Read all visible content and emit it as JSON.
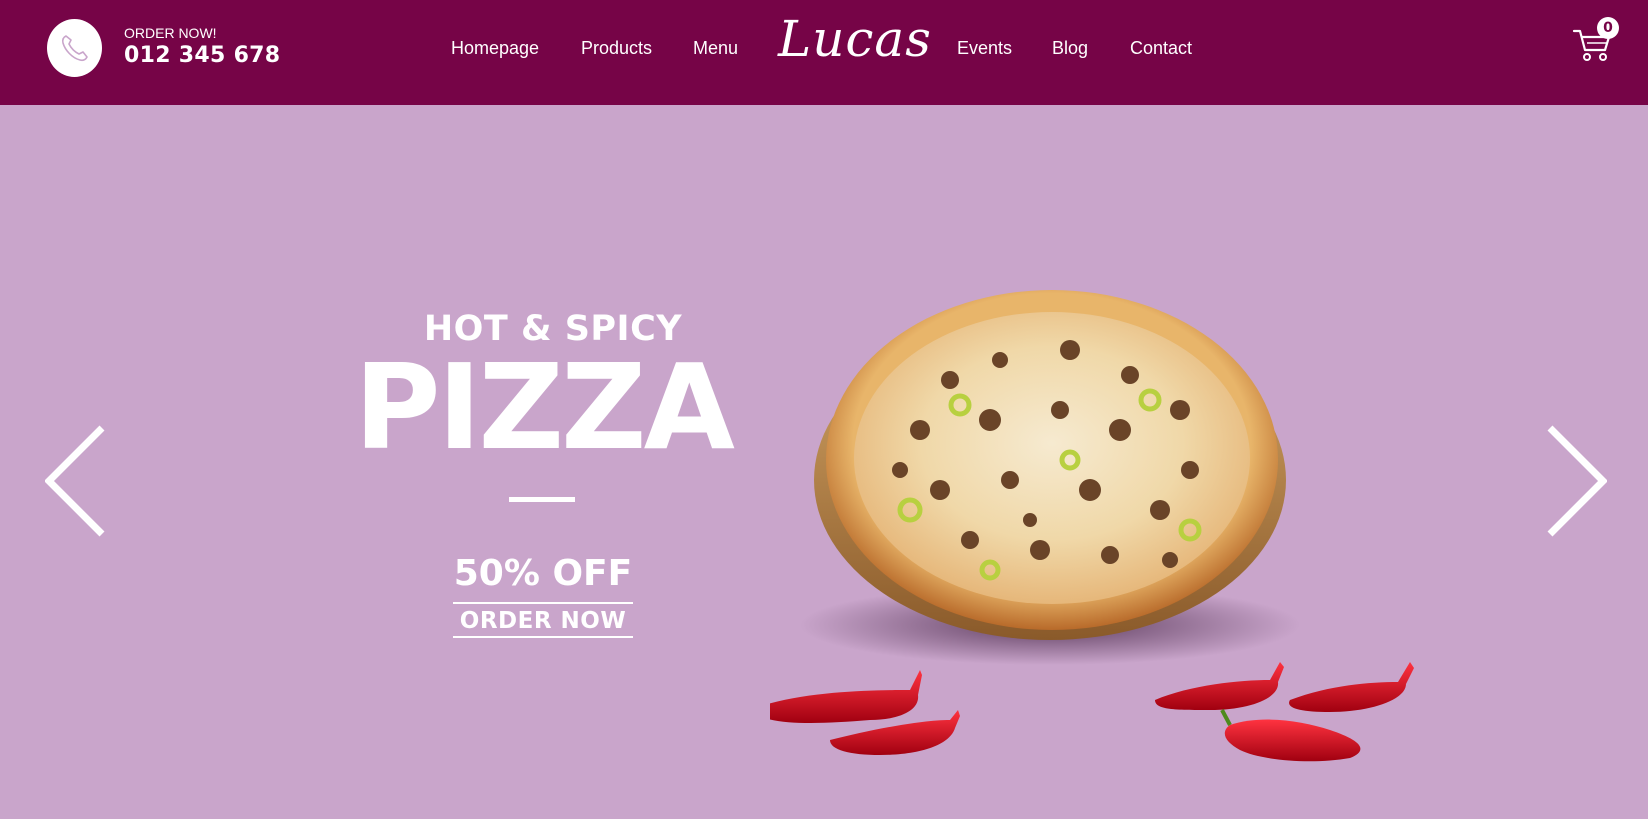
{
  "header": {
    "phone_icon": "phone-icon",
    "order_label": "ORDER NOW!",
    "order_number": "012 345 678",
    "logo": "Lucas",
    "nav_left": [
      "Homepage",
      "Products",
      "Menu"
    ],
    "nav_right": [
      "Events",
      "Blog",
      "Contact"
    ],
    "cart_icon": "shopping-cart-icon",
    "cart_count": "0"
  },
  "hero": {
    "subtitle": "HOT & SPICY",
    "title": "PIZZA",
    "discount": "50% OFF",
    "cta": "ORDER NOW",
    "prev_icon": "chevron-left-icon",
    "next_icon": "chevron-right-icon",
    "image": "pizza-with-red-chili-peppers"
  },
  "colors": {
    "header_bg": "#760447",
    "hero_bg": "#c9a5cb",
    "text": "#ffffff"
  }
}
